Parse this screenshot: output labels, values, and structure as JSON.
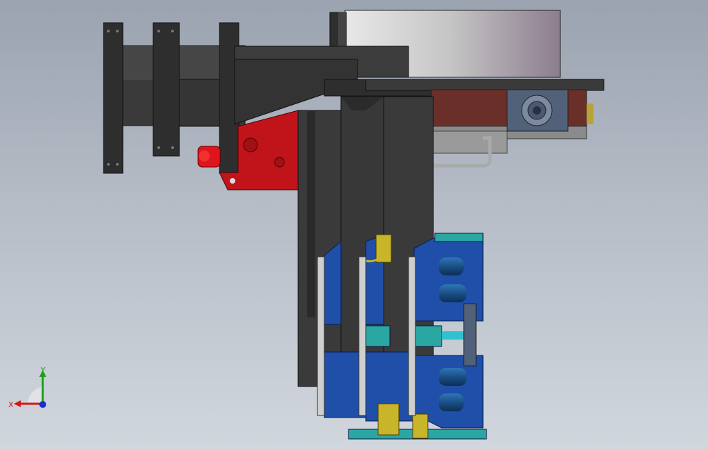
{
  "viewport": {
    "background_top": "#9ba3b0",
    "background_bottom": "#d2d7de"
  },
  "colors": {
    "dark_steel": "#3b3b3b",
    "steel_edge": "#1a1a1a",
    "motor_red": "#c0141a",
    "plate_brown": "#6b2f2a",
    "drum_silver": "#c8c8c8",
    "gripper_blue": "#1f4fa8",
    "teal": "#2aa6a3",
    "sensor_yellow": "#c8b52a",
    "roller_blue": "#1f5a92"
  },
  "triad": {
    "x_label": "X",
    "y_label": "Y",
    "x_color": "#d01818",
    "y_color": "#18a018",
    "z_color": "#1830d0"
  }
}
